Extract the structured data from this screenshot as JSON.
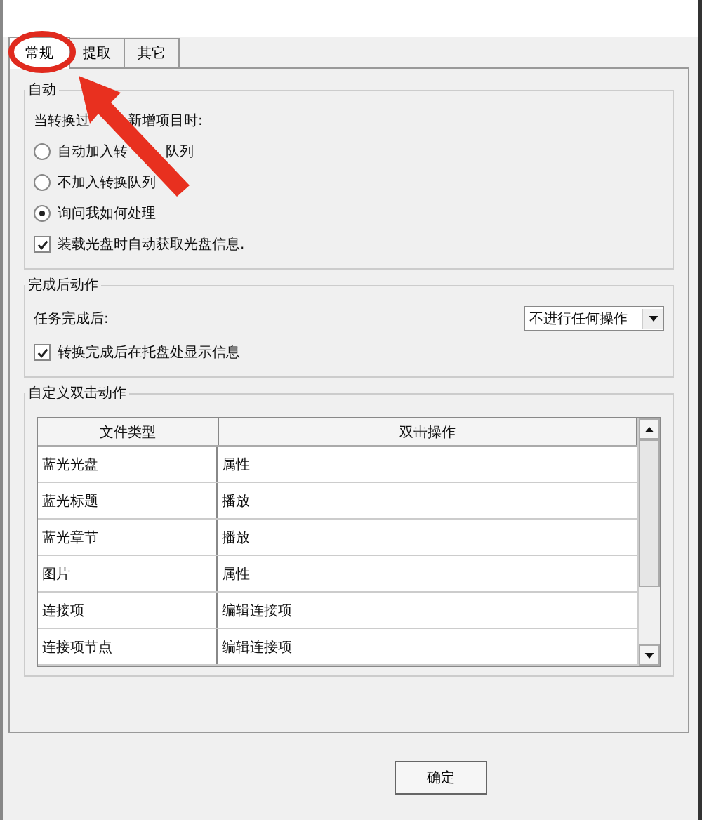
{
  "tabs": [
    {
      "label": "常规",
      "selected": true
    },
    {
      "label": "提取",
      "selected": false
    },
    {
      "label": "其它",
      "selected": false
    }
  ],
  "groups": [
    {
      "title": "自动",
      "kind": "options",
      "items": [
        {
          "kind": "text",
          "parts": [
            "当转换过",
            "新增项目时:"
          ]
        },
        {
          "kind": "radio",
          "selected": false,
          "parts": [
            "自动加入转",
            "队列"
          ]
        },
        {
          "kind": "radio",
          "selected": false,
          "parts": [
            "不加入转换队列"
          ]
        },
        {
          "kind": "radio",
          "selected": true,
          "parts": [
            "询问我如何处理"
          ]
        },
        {
          "kind": "checkbox",
          "checked": true,
          "parts": [
            "装载光盘时自动获取光盘信息."
          ]
        }
      ]
    },
    {
      "title": "完成后动作",
      "kind": "options",
      "items": [
        {
          "kind": "select",
          "label": "任务完成后:",
          "value": "不进行任何操作"
        },
        {
          "kind": "checkbox",
          "checked": true,
          "parts": [
            "转换完成后在托盘处显示信息"
          ]
        }
      ]
    },
    {
      "title": "自定义双击动作",
      "kind": "table",
      "columns": [
        "文件类型",
        "双击操作"
      ],
      "rows": [
        [
          "蓝光光盘",
          "属性"
        ],
        [
          "蓝光标题",
          "播放"
        ],
        [
          "蓝光章节",
          "播放"
        ],
        [
          "图片",
          "属性"
        ],
        [
          "连接项",
          "编辑连接项"
        ],
        [
          "连接项节点",
          "编辑连接项"
        ]
      ]
    }
  ],
  "buttons": [
    "确定"
  ]
}
